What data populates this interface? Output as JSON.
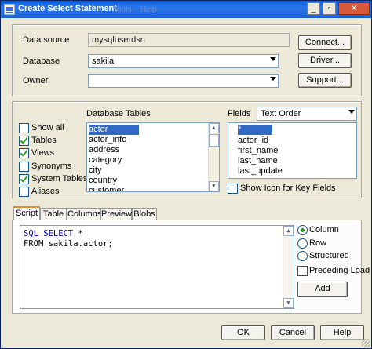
{
  "window": {
    "title": "Create Select Statement",
    "ghost_menus": [
      "Tools",
      "Help"
    ],
    "controls": [
      "_",
      "▫",
      "✕"
    ]
  },
  "connection": {
    "data_source_label": "Data source",
    "data_source_value": "mysqluserdsn",
    "database_label": "Database",
    "database_value": "sakila",
    "owner_label": "Owner",
    "owner_value": "",
    "connect_label": "Connect...",
    "driver_label": "Driver...",
    "support_label": "Support..."
  },
  "options": [
    {
      "label": "Show all",
      "checked": false
    },
    {
      "label": "Tables",
      "checked": true
    },
    {
      "label": "Views",
      "checked": true
    },
    {
      "label": "Synonyms",
      "checked": false
    },
    {
      "label": "System Tables",
      "checked": true
    },
    {
      "label": "Aliases",
      "checked": false
    }
  ],
  "tables": {
    "heading": "Database Tables",
    "items": [
      "actor",
      "actor_info",
      "address",
      "category",
      "city",
      "country",
      "customer"
    ],
    "selected": "actor"
  },
  "fields": {
    "label": "Fields",
    "order_value": "Text Order",
    "items": [
      "*",
      "actor_id",
      "first_name",
      "last_name",
      "last_update"
    ],
    "selected": "*",
    "show_icon_label": "Show Icon for Key Fields"
  },
  "tabs": [
    "Script",
    "Table",
    "Columns",
    "Preview",
    "Blobs"
  ],
  "active_tab": "Script",
  "script": {
    "line1_keyword": "SQL SELECT",
    "line1_rest": " *",
    "line2": "FROM sakila.actor;"
  },
  "layout_options": {
    "column_label": "Column",
    "row_label": "Row",
    "structured_label": "Structured",
    "selected": "Column",
    "preceding_load_label": "Preceding Load",
    "add_label": "Add"
  },
  "footer": {
    "ok_label": "OK",
    "cancel_label": "Cancel",
    "help_label": "Help"
  },
  "colors": {
    "title_bar": "#0a5ee0",
    "selection": "#316ac5",
    "sql_keyword": "#0000c0",
    "dialog_bg": "#ece9d8"
  }
}
